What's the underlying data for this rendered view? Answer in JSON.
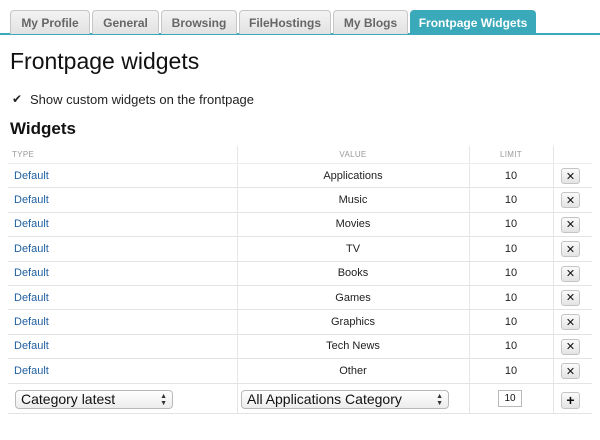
{
  "tabs": [
    {
      "label": "My Profile",
      "active": false
    },
    {
      "label": "General",
      "active": false
    },
    {
      "label": "Browsing",
      "active": false
    },
    {
      "label": "FileHostings",
      "active": false
    },
    {
      "label": "My Blogs",
      "active": false
    },
    {
      "label": "Frontpage Widgets",
      "active": true
    }
  ],
  "accent_color": "#3aa9b9",
  "page_title": "Frontpage widgets",
  "show_custom": {
    "label": "Show custom widgets on the frontpage",
    "checked": true
  },
  "section_title": "Widgets",
  "table": {
    "headers": {
      "type": "TYPE",
      "value": "VALUE",
      "limit": "LIMIT"
    },
    "rows": [
      {
        "type": "Default",
        "value": "Applications",
        "limit": "10",
        "action_icon": "close-icon"
      },
      {
        "type": "Default",
        "value": "Music",
        "limit": "10",
        "action_icon": "close-icon"
      },
      {
        "type": "Default",
        "value": "Movies",
        "limit": "10",
        "action_icon": "close-icon"
      },
      {
        "type": "Default",
        "value": "TV",
        "limit": "10",
        "action_icon": "close-icon"
      },
      {
        "type": "Default",
        "value": "Books",
        "limit": "10",
        "action_icon": "close-icon"
      },
      {
        "type": "Default",
        "value": "Games",
        "limit": "10",
        "action_icon": "close-icon"
      },
      {
        "type": "Default",
        "value": "Graphics",
        "limit": "10",
        "action_icon": "close-icon"
      },
      {
        "type": "Default",
        "value": "Tech News",
        "limit": "10",
        "action_icon": "close-icon"
      },
      {
        "type": "Default",
        "value": "Other",
        "limit": "10",
        "action_icon": "close-icon"
      }
    ]
  },
  "add_row": {
    "type_select": "Category latest",
    "value_select": "All Applications Category",
    "limit_value": "10",
    "add_icon": "plus-icon"
  }
}
